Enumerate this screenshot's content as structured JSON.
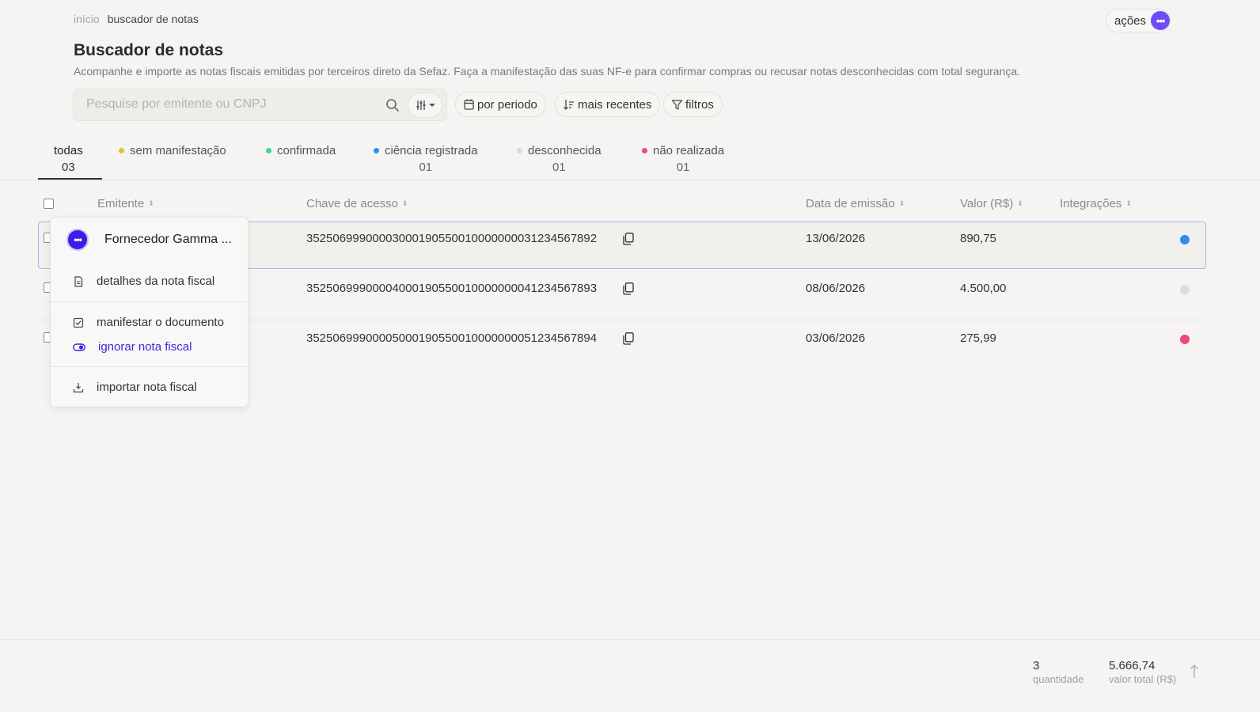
{
  "breadcrumb": {
    "home": "início",
    "current": "buscador de notas"
  },
  "header": {
    "actions_label": "ações",
    "actions_icon": "more-dots-icon"
  },
  "page": {
    "title": "Buscador de notas",
    "description": "Acompanhe e importe as notas fiscais emitidas por terceiros direto da Sefaz. Faça a manifestação das suas NF-e para confirmar compras ou recusar notas desconhecidas com total segurança."
  },
  "search": {
    "placeholder": "Pesquise por emitente ou CNPJ",
    "value": ""
  },
  "chips": {
    "period": "por periodo",
    "sort": "mais recentes",
    "filters": "filtros"
  },
  "tabs": [
    {
      "label": "todas",
      "count": "03",
      "dot": ""
    },
    {
      "label": "sem manifestação",
      "count": "",
      "dot": "#e6c229"
    },
    {
      "label": "confirmada",
      "count": "",
      "dot": "#3ed68a"
    },
    {
      "label": "ciência registrada",
      "count": "01",
      "dot": "#2f8cf0"
    },
    {
      "label": "desconhecida",
      "count": "01",
      "dot": "#d9d9d9"
    },
    {
      "label": "não realizada",
      "count": "01",
      "dot": "#f0467a"
    }
  ],
  "table": {
    "columns": [
      "Emitente",
      "Chave de acesso",
      "Data de emissão",
      "Valor (R$)",
      "Integrações"
    ],
    "rows": [
      {
        "key": "35250699900003000190550010000000031234567892",
        "date": "13/06/2026",
        "value": "890,75",
        "status_color": "#2f8cf0"
      },
      {
        "key": "35250699900004000190550010000000041234567893",
        "date": "08/06/2026",
        "value": "4.500,00",
        "status_color": "#dcdcdc"
      },
      {
        "key": "35250699900005000190550010000000051234567894",
        "date": "03/06/2026",
        "value": "275,99",
        "status_color": "#f0467a"
      }
    ]
  },
  "context_menu": {
    "title": "Fornecedor Gamma ...",
    "items": {
      "details": "detalhes da nota fiscal",
      "manifest": "manifestar o documento",
      "ignore": "ignorar nota fiscal",
      "import": "importar nota fiscal"
    }
  },
  "footer": {
    "quantity": "3",
    "quantity_label": "quantidade",
    "total": "5.666,74",
    "total_label": "valor total (R$)"
  },
  "colors": {
    "accent": "#6d4df5",
    "menu_accent": "#3a1ee8",
    "selected_border": "#a9b3f0"
  }
}
